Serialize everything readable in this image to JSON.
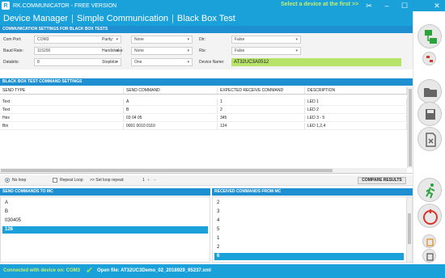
{
  "titlebar": {
    "app_title": "RK.COMMUNICATOR - FREE VERSION",
    "hint": "Select a device at the first >>"
  },
  "header": {
    "crumb1": "Device Manager",
    "crumb2": "Simple Communication",
    "crumb3": "Black Box Test"
  },
  "settings": {
    "heading": "COMMUNICATION SETTINGS FOR BLACK BOX TESTS",
    "com_port_label": "Com Port:",
    "com_port": "COM3",
    "baud_rate_label": "Baud Rate:",
    "baud_rate": "115200",
    "databits_label": "Databits:",
    "databits": "8",
    "parity_label": "Parity:",
    "parity": "None",
    "handshake_label": "Handshake:",
    "handshake": "None",
    "stopbits_label": "Stopbits:",
    "stopbits": "One",
    "dtr_label": "Dtr:",
    "dtr": "False",
    "rts_label": "Rts:",
    "rts": "False",
    "device_name_label": "Device Name:",
    "device_name": "AT32UC3A0512"
  },
  "commands": {
    "heading": "BLACK BOX TEST COMMAND SETTINGS",
    "columns": [
      "SEND TYPE",
      "SEND COMMAND",
      "EXPECTED RECEIVE COMMAND",
      "DESCRIPTION"
    ],
    "rows": [
      [
        "Text",
        "A",
        "1",
        "LED 1"
      ],
      [
        "Text",
        "B",
        "2",
        "LED 2"
      ],
      [
        "Hex",
        "03 04 05",
        "345",
        "LED 3 - 5"
      ],
      [
        "Bin",
        "0001 0010 0110",
        "124",
        "LED 1,2,4"
      ]
    ]
  },
  "loop": {
    "no_loop": "No loop",
    "repeat_loop": "Repeat Loop",
    "set_repeat": ">> Set loop repeat:",
    "repeat_value": "1",
    "compare": "COMPARE RESULTS"
  },
  "sent": {
    "heading": "SEND COMMANDS TO MC",
    "items": [
      "A",
      "B",
      "030405",
      "126"
    ]
  },
  "received": {
    "heading": "RECEIVED COMMANDS FROM MC",
    "items": [
      "2",
      "3",
      "4",
      "5",
      "1",
      "2",
      "6"
    ]
  },
  "status": {
    "connected": "Connected with device on: COM3",
    "open_file": "Open file: AT32UC3Demo_02_2018929_95237.xml"
  },
  "colors": {
    "accent": "#1ba1d9",
    "section": "#1e8fd0",
    "highlight_green": "#b7e36a",
    "status_green": "#c6f06b"
  }
}
